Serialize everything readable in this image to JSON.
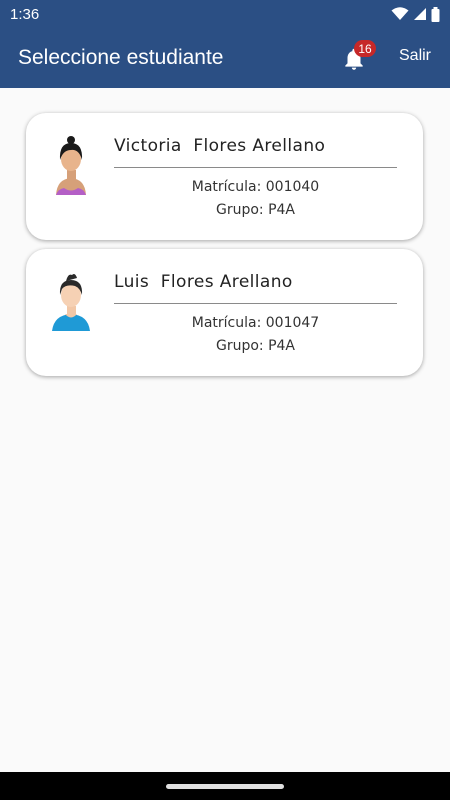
{
  "status_bar": {
    "time": "1:36"
  },
  "app_bar": {
    "title": "Seleccione estudiante",
    "notification_count": "16",
    "logout_label": "Salir"
  },
  "students": [
    {
      "name": "Victoria  Flores Arellano",
      "matricula": "Matrícula: 001040",
      "grupo": "Grupo: P4A"
    },
    {
      "name": "Luis  Flores Arellano",
      "matricula": "Matrícula: 001047",
      "grupo": "Grupo: P4A"
    }
  ],
  "colors": {
    "app_bar": "#2b4f84",
    "badge": "#c62828",
    "background": "#fafafa"
  },
  "icons": [
    "wifi-icon",
    "signal-icon",
    "battery-icon",
    "bell-icon",
    "female-student-avatar-icon",
    "male-student-avatar-icon"
  ]
}
